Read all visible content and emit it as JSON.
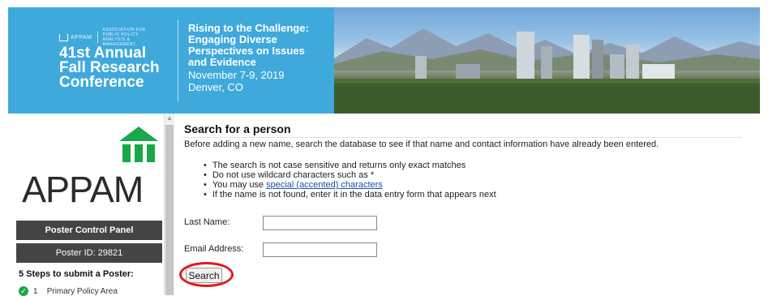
{
  "banner": {
    "org_small": "APPAM",
    "org_tagline": "ASSOCIATION FOR PUBLIC POLICY ANALYSIS & MANAGEMENT",
    "conference_lines": [
      "41st Annual",
      "Fall Research",
      "Conference"
    ],
    "tagline_lines": [
      "Rising to the Challenge:",
      "Engaging Diverse",
      "Perspectives on Issues",
      "and Evidence"
    ],
    "dates": "November 7-9, 2019",
    "location": "Denver, CO"
  },
  "sidebar": {
    "logo_text": "APPAM",
    "panel_title": "Poster Control Panel",
    "poster_id": "Poster ID: 29821",
    "steps_heading": "5 Steps to submit a Poster:",
    "step1_number": "1",
    "step1_label": "Primary Policy Area"
  },
  "main": {
    "title": "Search for a person",
    "intro": "Before adding a new name, search the database to see if that name and contact information have already been entered.",
    "bullet1": "The search is not case sensitive and returns only exact matches",
    "bullet2": "Do not use wildcard characters such as *",
    "bullet3_prefix": "You may use ",
    "bullet3_link": "special (accented) characters",
    "bullet4": "If the name is not found, enter it in the data entry form that appears next",
    "last_name_label": "Last Name:",
    "last_name_value": "",
    "email_label": "Email Address:",
    "email_value": "",
    "search_label": "Search"
  },
  "colors": {
    "banner_blue": "#3fa9dc",
    "appam_green": "#18a84a",
    "panel_gray": "#444444",
    "highlight_red": "#e01b1b",
    "link_blue": "#1a4fa8"
  }
}
